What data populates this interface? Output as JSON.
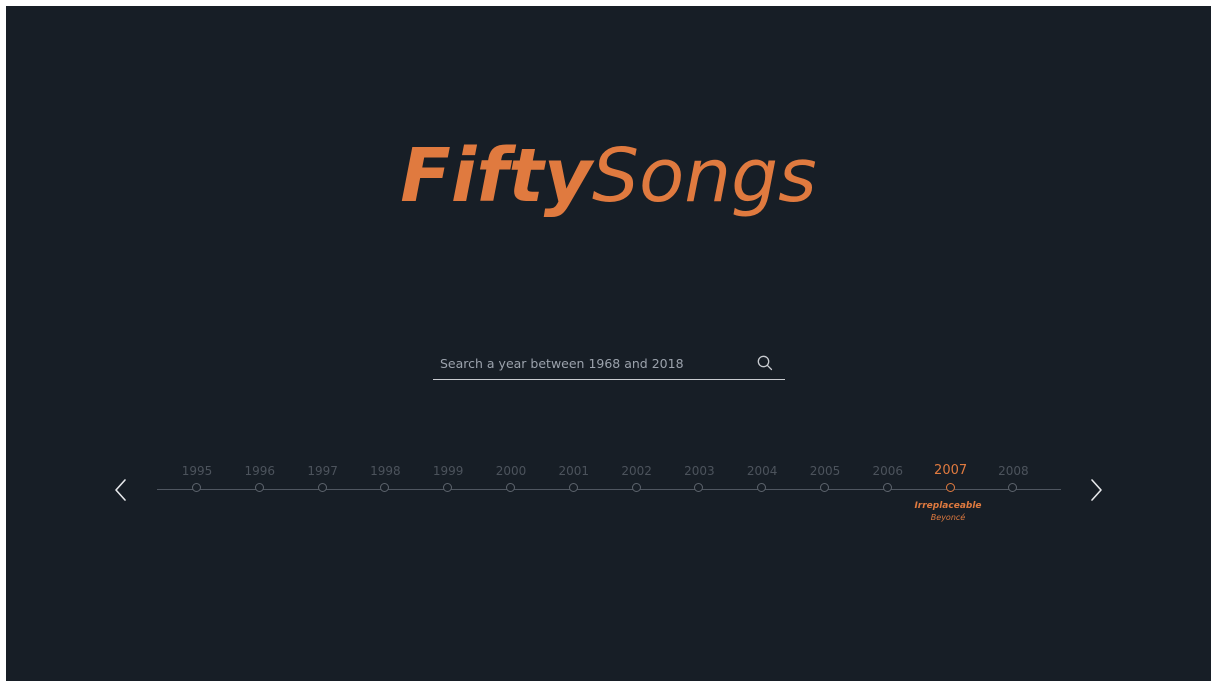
{
  "colors": {
    "background": "#171e26",
    "accent": "#e07a3f",
    "inactive_year": "#4c535c",
    "line": "#4f5660",
    "arrow": "#e6e8eb",
    "search_icon": "#c8cbd0"
  },
  "logo": {
    "bold": "Fifty",
    "light": "Songs"
  },
  "search": {
    "placeholder": "Search a year between 1968 and 2018",
    "value": "",
    "icon": "search-icon"
  },
  "timeline": {
    "prev_icon": "chevron-left-icon",
    "next_icon": "chevron-right-icon",
    "selected_year": "2007",
    "years": [
      "1995",
      "1996",
      "1997",
      "1998",
      "1999",
      "2000",
      "2001",
      "2002",
      "2003",
      "2004",
      "2005",
      "2006",
      "2007",
      "2008"
    ],
    "selected_song": {
      "title": "Irreplaceable",
      "artist": "Beyoncé"
    }
  }
}
